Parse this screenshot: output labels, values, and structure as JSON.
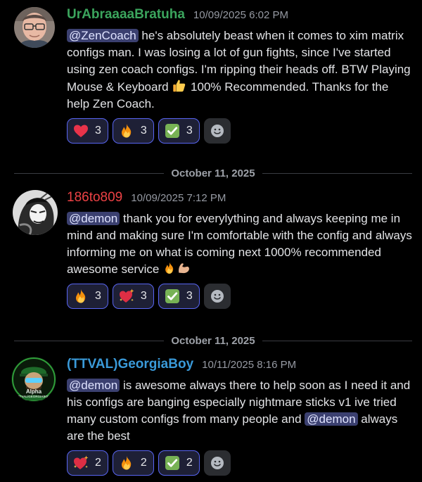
{
  "messages": [
    {
      "username": "UrAbraaaaBratuha",
      "username_color": "#3ba55d",
      "timestamp": "10/09/2025 6:02 PM",
      "mention": "@ZenCoach",
      "text_1": " he's absolutely beast when it comes to xim matrix configs man. I was losing a lot of gun fights, since I've started using zen coach configs. I'm ripping their heads off. BTW Playing Mouse & Keyboard ",
      "text_2": " 100% Recommended. Thanks for the help Zen Coach.",
      "reactions": [
        {
          "icon": "heart-emoji",
          "count": "3"
        },
        {
          "icon": "fire-emoji",
          "count": "3"
        },
        {
          "icon": "check-emoji",
          "count": "3"
        }
      ]
    },
    {
      "username": "186to809",
      "username_color": "#ed4245",
      "timestamp": "10/09/2025 7:12 PM",
      "mention": "@demon",
      "text_1": "  thank you for everylything and always keeping me in mind and making sure I'm comfortable with the config and always informing me on what is coming next 1000% recommended awesome service ",
      "reactions": [
        {
          "icon": "fire-emoji",
          "count": "3"
        },
        {
          "icon": "sparkling-heart-emoji",
          "count": "3"
        },
        {
          "icon": "check-emoji",
          "count": "3"
        }
      ]
    },
    {
      "username": "(TTVAL)GeorgiaBoy",
      "username_color": "#3a9ad9",
      "timestamp": "10/11/2025 8:16 PM",
      "mention": "@demon",
      "text_1": "  is  awesome always there to help soon as I need it and his configs are banging especially nightmare sticks v1 ive tried many custom configs from many people and ",
      "mention_2": "@demon",
      "text_2": "  always are the best",
      "avatar_text_1": "Alpha",
      "avatar_text_2": "TTVAL/GEORGIABOY",
      "reactions": [
        {
          "icon": "sparkling-heart-emoji",
          "count": "2"
        },
        {
          "icon": "fire-emoji",
          "count": "2"
        },
        {
          "icon": "check-emoji",
          "count": "2"
        }
      ]
    }
  ],
  "dividers": [
    "October 11, 2025",
    "October 11, 2025"
  ]
}
